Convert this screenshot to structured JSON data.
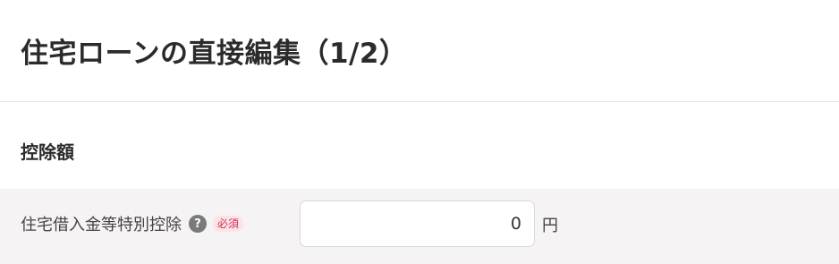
{
  "header": {
    "title": "住宅ローンの直接編集（1/2）"
  },
  "section": {
    "title": "控除額"
  },
  "form": {
    "field_label": "住宅借入金等特別控除",
    "help_icon_glyph": "?",
    "required_badge": "必須",
    "amount_value": "0",
    "unit": "円"
  },
  "colors": {
    "row_background": "#f5f3f3",
    "badge_background": "#fbe3e8",
    "badge_text": "#d0304f"
  }
}
